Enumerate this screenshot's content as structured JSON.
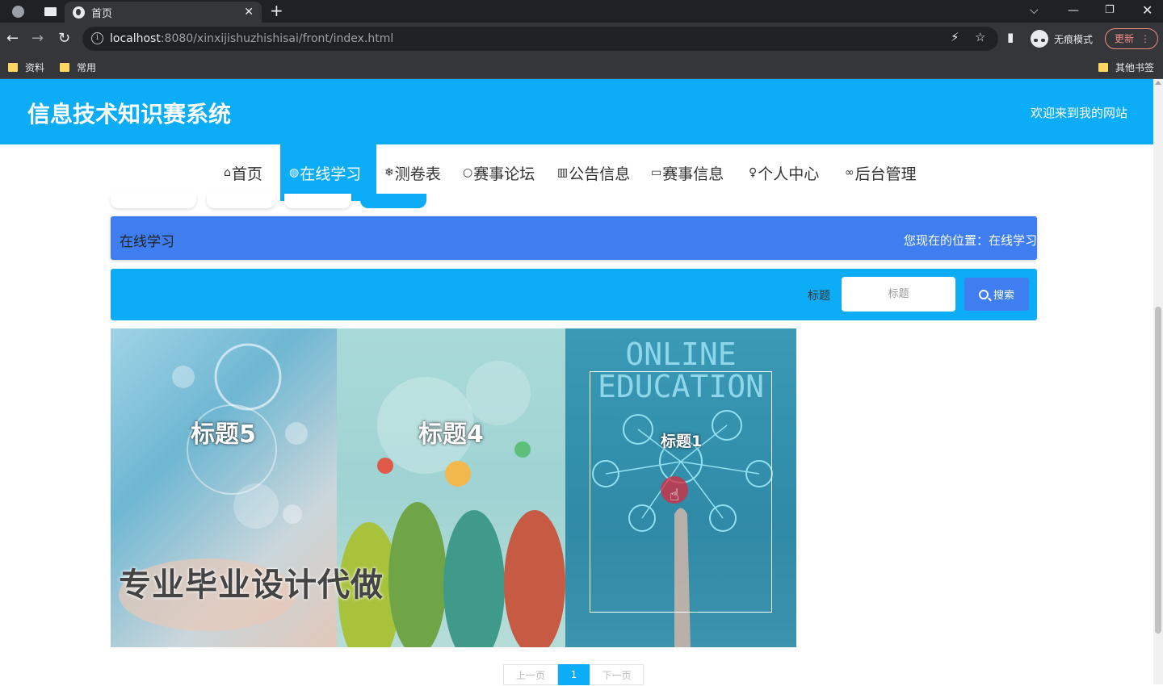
{
  "browser": {
    "tab_title": "首页",
    "url_host": "localhost",
    "url_path": ":8080/xinxijishuzhishisai/front/index.html",
    "incognito_label": "无痕模式",
    "update_label": "更新",
    "bookmarks": [
      "资料",
      "常用"
    ],
    "other_bookmarks": "其他书签"
  },
  "header": {
    "title": "信息技术知识赛系统",
    "welcome": "欢迎来到我的网站"
  },
  "nav": {
    "items": [
      {
        "icon": "⌂",
        "label": "首页"
      },
      {
        "icon": "◍",
        "label": "在线学习"
      },
      {
        "icon": "❄",
        "label": "测卷表"
      },
      {
        "icon": "○",
        "label": "赛事论坛"
      },
      {
        "icon": "▥",
        "label": "公告信息"
      },
      {
        "icon": "▭",
        "label": "赛事信息"
      },
      {
        "icon": "♀",
        "label": "个人中心"
      },
      {
        "icon": "∞",
        "label": "后台管理"
      }
    ],
    "active_index": 1
  },
  "breadcrumb": {
    "title": "在线学习",
    "position": "您现在的位置：在线学习"
  },
  "search": {
    "label": "标题",
    "placeholder": "标题",
    "button": "搜索"
  },
  "cards": [
    {
      "title": "标题5"
    },
    {
      "title": "标题4"
    },
    {
      "title": "标题1",
      "image_text_line1": "ONLINE",
      "image_text_line2": "EDUCATION"
    }
  ],
  "watermark": "专业毕业设计代做",
  "pagination": {
    "prev": "上一页",
    "current": "1",
    "next": "下一页"
  },
  "colors": {
    "primary": "#0cacf6",
    "secondary": "#3e7ef0"
  }
}
